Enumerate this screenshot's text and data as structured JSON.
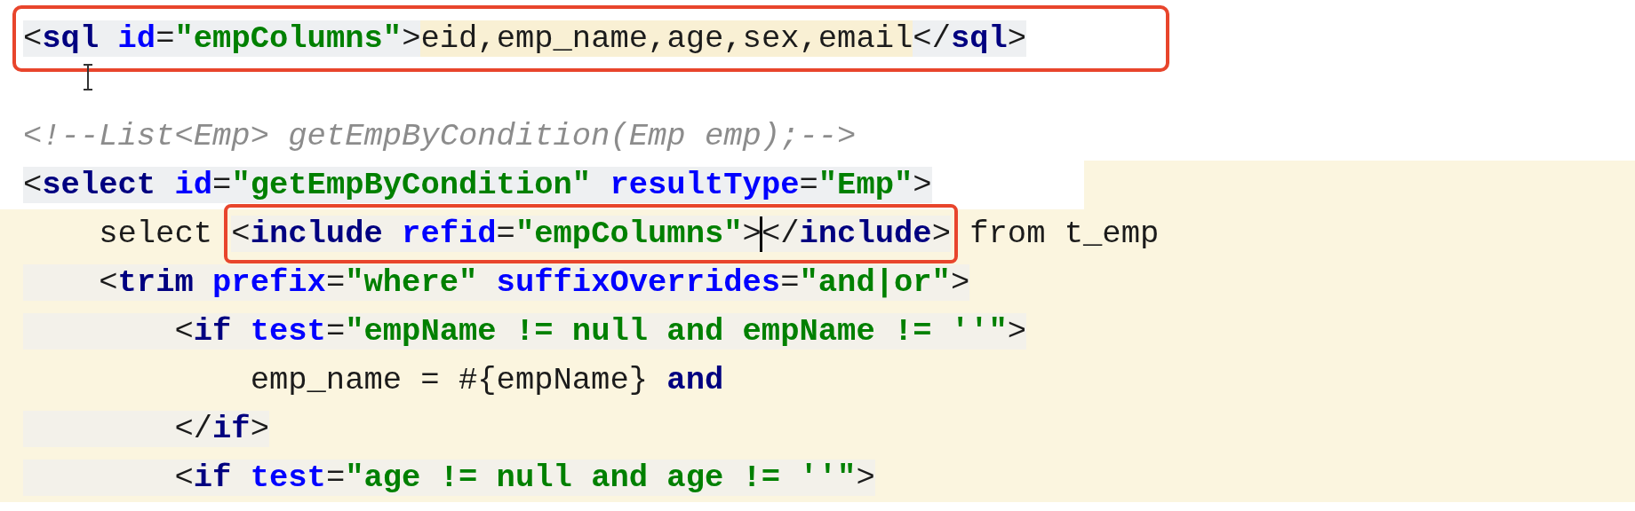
{
  "editor": {
    "lines": [
      {
        "boxed": true,
        "highlighted": false,
        "segments": [
          {
            "kind": "tag",
            "parts": [
              {
                "kind": "punct",
                "text": "<"
              },
              {
                "kind": "tag",
                "text": "sql"
              },
              {
                "kind": "attr",
                "text": " id"
              },
              {
                "kind": "punct",
                "text": "="
              },
              {
                "kind": "value",
                "text": "\"empColumns\""
              },
              {
                "kind": "punct",
                "text": ">"
              }
            ]
          },
          {
            "kind": "content",
            "parts": [
              {
                "kind": "text",
                "text": "eid,emp_name,age,sex,email"
              }
            ]
          },
          {
            "kind": "tag",
            "parts": [
              {
                "kind": "punct",
                "text": "</"
              },
              {
                "kind": "tag",
                "text": "sql"
              },
              {
                "kind": "punct",
                "text": ">"
              }
            ]
          }
        ]
      },
      {
        "boxed": false,
        "highlighted": false
      },
      {
        "boxed": false,
        "highlighted": false,
        "segments": [
          {
            "kind": "comment",
            "parts": [
              {
                "kind": "comment",
                "text": "<!--List<Emp> getEmpByCondition(Emp emp);-->"
              }
            ]
          }
        ]
      },
      {
        "boxed": false,
        "highlighted": true,
        "segments": [
          {
            "kind": "tag",
            "parts": [
              {
                "kind": "punct",
                "text": "<"
              },
              {
                "kind": "tag",
                "text": "select"
              },
              {
                "kind": "attr",
                "text": " id"
              },
              {
                "kind": "punct",
                "text": "="
              },
              {
                "kind": "value",
                "text": "\"getEmpByCondition\""
              },
              {
                "kind": "attr",
                "text": " resultType"
              },
              {
                "kind": "punct",
                "text": "="
              },
              {
                "kind": "value",
                "text": "\"Emp\""
              },
              {
                "kind": "punct",
                "text": ">"
              }
            ]
          }
        ]
      },
      {
        "boxed": false,
        "highlighted": true,
        "segments": [
          {
            "kind": "plain",
            "parts": [
              {
                "kind": "text",
                "text": "    select "
              }
            ]
          },
          {
            "kind": "boxed",
            "parts": [
              {
                "kind": "punct",
                "text": "<"
              },
              {
                "kind": "tag",
                "text": "include"
              },
              {
                "kind": "attr",
                "text": " refid"
              },
              {
                "kind": "punct",
                "text": "="
              },
              {
                "kind": "value",
                "text": "\"empColumns\""
              },
              {
                "kind": "punct",
                "text": ">"
              },
              {
                "kind": "caret"
              },
              {
                "kind": "punct",
                "text": "</"
              },
              {
                "kind": "tag",
                "text": "include"
              },
              {
                "kind": "punct",
                "text": ">"
              }
            ]
          },
          {
            "kind": "plain",
            "parts": [
              {
                "kind": "text",
                "text": " from t_emp"
              }
            ]
          }
        ]
      },
      {
        "boxed": false,
        "highlighted": true,
        "segments": [
          {
            "kind": "tag",
            "parts": [
              {
                "kind": "punct",
                "text": "    <"
              },
              {
                "kind": "tag",
                "text": "trim"
              },
              {
                "kind": "attr",
                "text": " prefix"
              },
              {
                "kind": "punct",
                "text": "="
              },
              {
                "kind": "value",
                "text": "\"where\""
              },
              {
                "kind": "attr",
                "text": " suffixOverrides"
              },
              {
                "kind": "punct",
                "text": "="
              },
              {
                "kind": "value",
                "text": "\"and|or\""
              },
              {
                "kind": "punct",
                "text": ">"
              }
            ]
          }
        ]
      },
      {
        "boxed": false,
        "highlighted": true,
        "segments": [
          {
            "kind": "tag",
            "parts": [
              {
                "kind": "punct",
                "text": "        <"
              },
              {
                "kind": "tag",
                "text": "if"
              },
              {
                "kind": "attr",
                "text": " test"
              },
              {
                "kind": "punct",
                "text": "="
              },
              {
                "kind": "value",
                "text": "\"empName != null and empName != ''\""
              },
              {
                "kind": "punct",
                "text": ">"
              }
            ]
          }
        ]
      },
      {
        "boxed": false,
        "highlighted": true,
        "segments": [
          {
            "kind": "plain",
            "parts": [
              {
                "kind": "text",
                "text": "            emp_name = #{empName} "
              },
              {
                "kind": "tag",
                "text": "and"
              }
            ]
          }
        ]
      },
      {
        "boxed": false,
        "highlighted": true,
        "segments": [
          {
            "kind": "tag",
            "parts": [
              {
                "kind": "punct",
                "text": "        </"
              },
              {
                "kind": "tag",
                "text": "if"
              },
              {
                "kind": "punct",
                "text": ">"
              }
            ]
          }
        ]
      },
      {
        "boxed": false,
        "highlighted": true,
        "segments": [
          {
            "kind": "tag",
            "parts": [
              {
                "kind": "punct",
                "text": "        <"
              },
              {
                "kind": "tag",
                "text": "if"
              },
              {
                "kind": "attr",
                "text": " test"
              },
              {
                "kind": "punct",
                "text": "="
              },
              {
                "kind": "value",
                "text": "\"age != null and age != ''\""
              },
              {
                "kind": "punct",
                "text": ">"
              }
            ]
          }
        ]
      }
    ]
  }
}
